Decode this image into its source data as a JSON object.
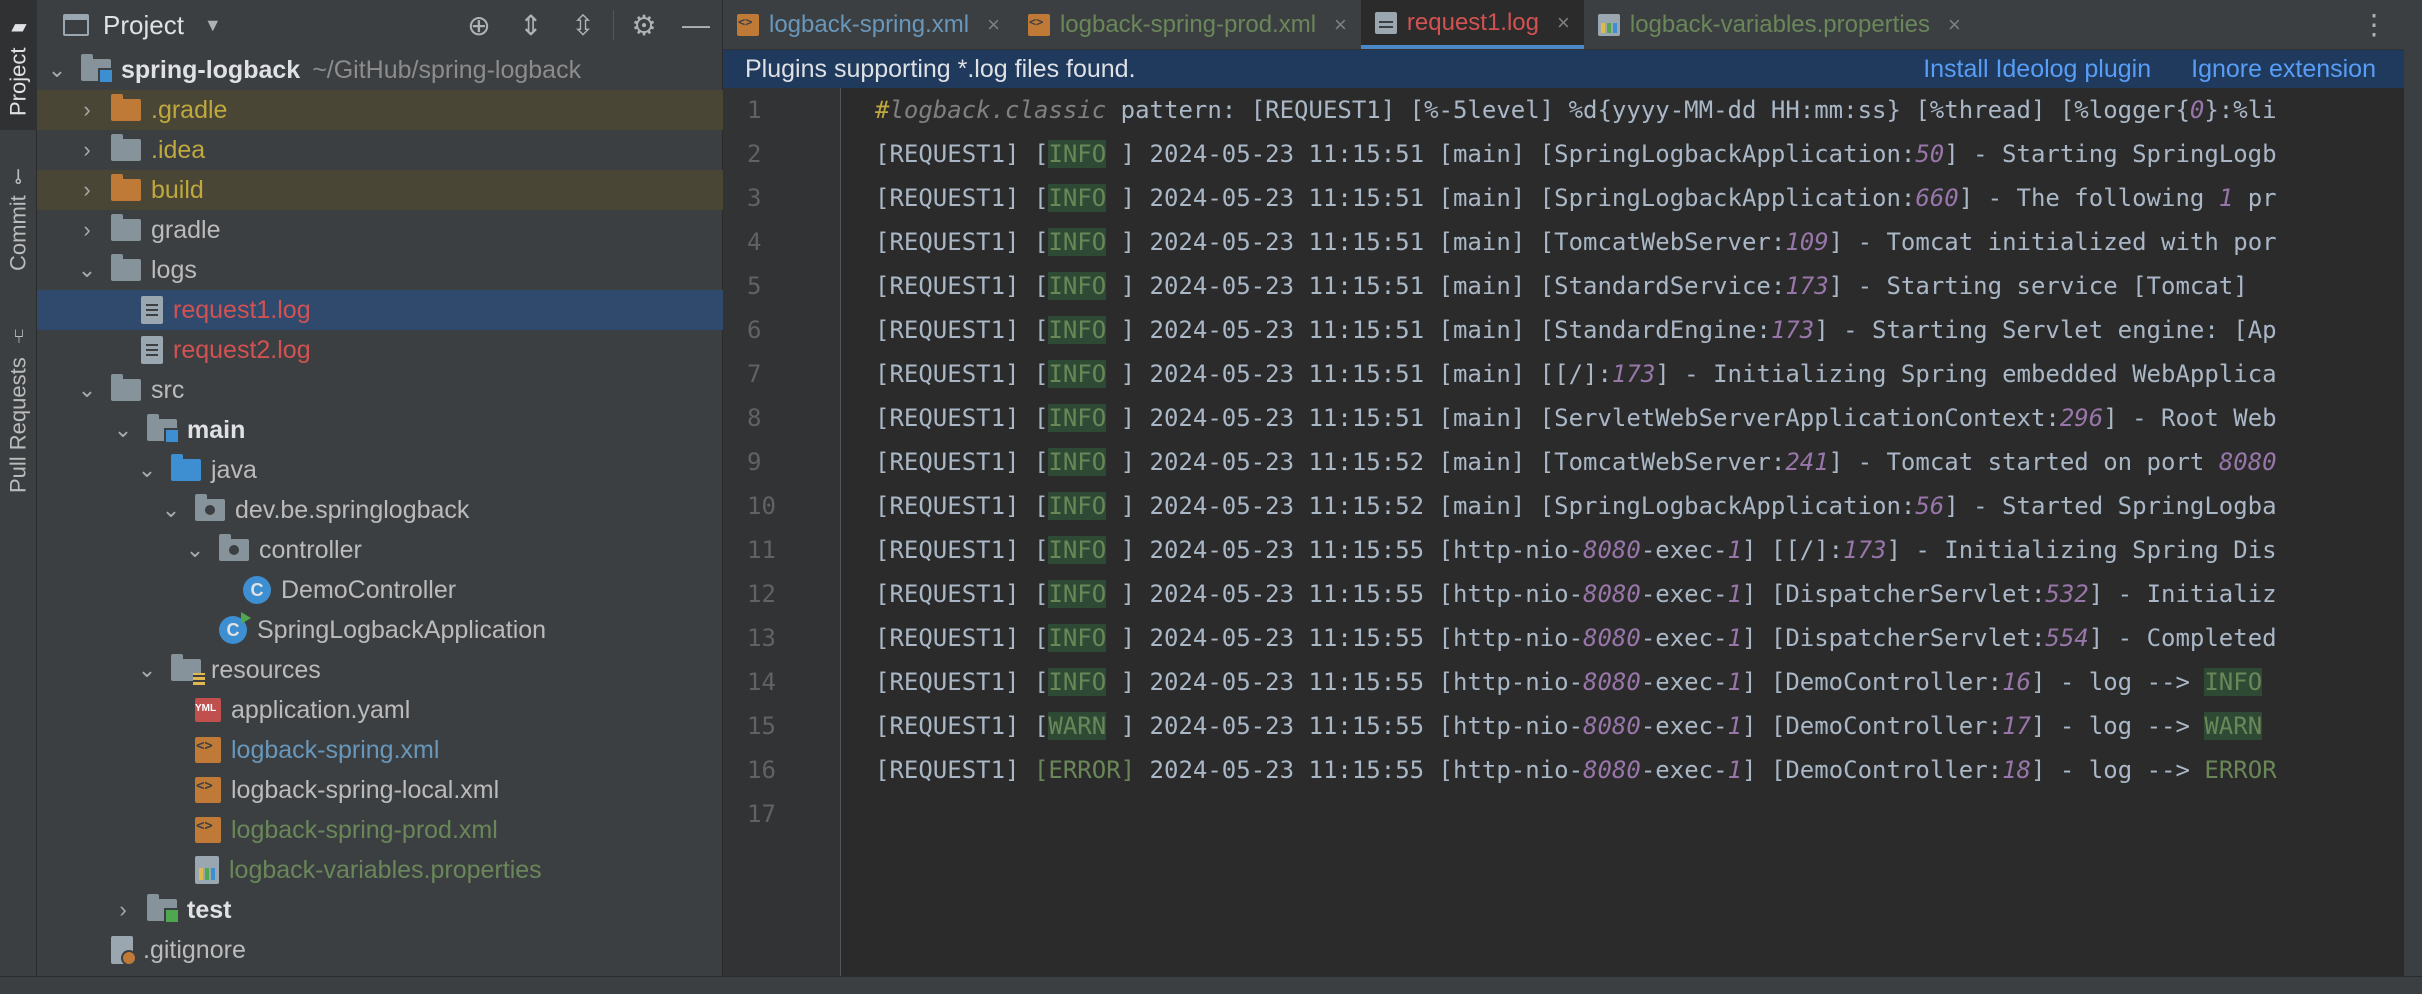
{
  "tool_strip": {
    "project": "Project",
    "commit": "Commit",
    "pull_requests": "Pull Requests"
  },
  "project_panel": {
    "title": "Project",
    "tree": [
      {
        "label": "spring-logback",
        "extra": "~/GitHub/spring-logback"
      },
      {
        "label": ".gradle"
      },
      {
        "label": ".idea"
      },
      {
        "label": "build"
      },
      {
        "label": "gradle"
      },
      {
        "label": "logs"
      },
      {
        "label": "request1.log"
      },
      {
        "label": "request2.log"
      },
      {
        "label": "src"
      },
      {
        "label": "main"
      },
      {
        "label": "java"
      },
      {
        "label": "dev.be.springlogback"
      },
      {
        "label": "controller"
      },
      {
        "label": "DemoController"
      },
      {
        "label": "SpringLogbackApplication"
      },
      {
        "label": "resources"
      },
      {
        "label": "application.yaml"
      },
      {
        "label": "logback-spring.xml"
      },
      {
        "label": "logback-spring-local.xml"
      },
      {
        "label": "logback-spring-prod.xml"
      },
      {
        "label": "logback-variables.properties"
      },
      {
        "label": "test"
      },
      {
        "label": ".gitignore"
      }
    ]
  },
  "editor": {
    "tabs": [
      {
        "label": "logback-spring.xml"
      },
      {
        "label": "logback-spring-prod.xml"
      },
      {
        "label": "request1.log"
      },
      {
        "label": "logback-variables.properties"
      }
    ],
    "banner": {
      "text": "Plugins supporting *.log files found.",
      "install": "Install Ideolog plugin",
      "ignore": "Ignore extension"
    },
    "lines": [
      {
        "n": "1",
        "parts": [
          [
            "cm-hash",
            "#"
          ],
          [
            "cm",
            "logback.classic"
          ],
          [
            "",
            " pattern: [REQUEST1] [%-5level] %d{yyyy-MM-dd HH:mm:ss} [%thread] [%logger{"
          ],
          [
            "num",
            "0"
          ],
          [
            "",
            "}:%li"
          ]
        ]
      },
      {
        "n": "2",
        "parts": [
          [
            "",
            "[REQUEST1] ["
          ],
          [
            "lvl",
            "INFO"
          ],
          [
            "",
            " ] 2024-05-23 11:15:51 [main] [SpringLogbackApplication:"
          ],
          [
            "num",
            "50"
          ],
          [
            "",
            "] - Starting SpringLogb"
          ]
        ]
      },
      {
        "n": "3",
        "parts": [
          [
            "",
            "[REQUEST1] ["
          ],
          [
            "lvl",
            "INFO"
          ],
          [
            "",
            " ] 2024-05-23 11:15:51 [main] [SpringLogbackApplication:"
          ],
          [
            "num",
            "660"
          ],
          [
            "",
            "] - The following "
          ],
          [
            "num",
            "1"
          ],
          [
            "",
            " pr"
          ]
        ]
      },
      {
        "n": "4",
        "parts": [
          [
            "",
            "[REQUEST1] ["
          ],
          [
            "lvl",
            "INFO"
          ],
          [
            "",
            " ] 2024-05-23 11:15:51 [main] [TomcatWebServer:"
          ],
          [
            "num",
            "109"
          ],
          [
            "",
            "] - Tomcat initialized with por"
          ]
        ]
      },
      {
        "n": "5",
        "parts": [
          [
            "",
            "[REQUEST1] ["
          ],
          [
            "lvl",
            "INFO"
          ],
          [
            "",
            " ] 2024-05-23 11:15:51 [main] [StandardService:"
          ],
          [
            "num",
            "173"
          ],
          [
            "",
            "] - Starting service [Tomcat]"
          ]
        ]
      },
      {
        "n": "6",
        "parts": [
          [
            "",
            "[REQUEST1] ["
          ],
          [
            "lvl",
            "INFO"
          ],
          [
            "",
            " ] 2024-05-23 11:15:51 [main] [StandardEngine:"
          ],
          [
            "num",
            "173"
          ],
          [
            "",
            "] - Starting Servlet engine: [Ap"
          ]
        ]
      },
      {
        "n": "7",
        "parts": [
          [
            "",
            "[REQUEST1] ["
          ],
          [
            "lvl",
            "INFO"
          ],
          [
            "",
            " ] 2024-05-23 11:15:51 [main] [[/]:"
          ],
          [
            "num",
            "173"
          ],
          [
            "",
            "] - Initializing Spring embedded WebApplica"
          ]
        ]
      },
      {
        "n": "8",
        "parts": [
          [
            "",
            "[REQUEST1] ["
          ],
          [
            "lvl",
            "INFO"
          ],
          [
            "",
            " ] 2024-05-23 11:15:51 [main] [ServletWebServerApplicationContext:"
          ],
          [
            "num",
            "296"
          ],
          [
            "",
            "] - Root Web"
          ]
        ]
      },
      {
        "n": "9",
        "parts": [
          [
            "",
            "[REQUEST1] ["
          ],
          [
            "lvl",
            "INFO"
          ],
          [
            "",
            " ] 2024-05-23 11:15:52 [main] [TomcatWebServer:"
          ],
          [
            "num",
            "241"
          ],
          [
            "",
            "] - Tomcat started on port "
          ],
          [
            "num",
            "8080"
          ]
        ]
      },
      {
        "n": "10",
        "parts": [
          [
            "",
            "[REQUEST1] ["
          ],
          [
            "lvl",
            "INFO"
          ],
          [
            "",
            " ] 2024-05-23 11:15:52 [main] [SpringLogbackApplication:"
          ],
          [
            "num",
            "56"
          ],
          [
            "",
            "] - Started SpringLogba"
          ]
        ]
      },
      {
        "n": "11",
        "parts": [
          [
            "",
            "[REQUEST1] ["
          ],
          [
            "lvl",
            "INFO"
          ],
          [
            "",
            " ] 2024-05-23 11:15:55 [http-nio-"
          ],
          [
            "num",
            "8080"
          ],
          [
            "",
            "-exec-"
          ],
          [
            "num",
            "1"
          ],
          [
            "",
            "] [[/]:"
          ],
          [
            "num",
            "173"
          ],
          [
            "",
            "] - Initializing Spring Dis"
          ]
        ]
      },
      {
        "n": "12",
        "parts": [
          [
            "",
            "[REQUEST1] ["
          ],
          [
            "lvl",
            "INFO"
          ],
          [
            "",
            " ] 2024-05-23 11:15:55 [http-nio-"
          ],
          [
            "num",
            "8080"
          ],
          [
            "",
            "-exec-"
          ],
          [
            "num",
            "1"
          ],
          [
            "",
            "] [DispatcherServlet:"
          ],
          [
            "num",
            "532"
          ],
          [
            "",
            "] - Initializ"
          ]
        ]
      },
      {
        "n": "13",
        "parts": [
          [
            "",
            "[REQUEST1] ["
          ],
          [
            "lvl",
            "INFO"
          ],
          [
            "",
            " ] 2024-05-23 11:15:55 [http-nio-"
          ],
          [
            "num",
            "8080"
          ],
          [
            "",
            "-exec-"
          ],
          [
            "num",
            "1"
          ],
          [
            "",
            "] [DispatcherServlet:"
          ],
          [
            "num",
            "554"
          ],
          [
            "",
            "] - Completed"
          ]
        ]
      },
      {
        "n": "14",
        "parts": [
          [
            "",
            "[REQUEST1] ["
          ],
          [
            "lvl",
            "INFO"
          ],
          [
            "",
            " ] 2024-05-23 11:15:55 [http-nio-"
          ],
          [
            "num",
            "8080"
          ],
          [
            "",
            "-exec-"
          ],
          [
            "num",
            "1"
          ],
          [
            "",
            "] [DemoController:"
          ],
          [
            "num",
            "16"
          ],
          [
            "",
            "] - log --> "
          ],
          [
            "lvl",
            "INFO"
          ]
        ]
      },
      {
        "n": "15",
        "parts": [
          [
            "",
            "[REQUEST1] ["
          ],
          [
            "lvl",
            "WARN"
          ],
          [
            "",
            " ] 2024-05-23 11:15:55 [http-nio-"
          ],
          [
            "num",
            "8080"
          ],
          [
            "",
            "-exec-"
          ],
          [
            "num",
            "1"
          ],
          [
            "",
            "] [DemoController:"
          ],
          [
            "num",
            "17"
          ],
          [
            "",
            "] - log --> "
          ],
          [
            "lvl",
            "WARN"
          ]
        ]
      },
      {
        "n": "16",
        "parts": [
          [
            "",
            "[REQUEST1] "
          ],
          [
            "err",
            "[ERROR]"
          ],
          [
            "",
            " 2024-05-23 11:15:55 [http-nio-"
          ],
          [
            "num",
            "8080"
          ],
          [
            "",
            "-exec-"
          ],
          [
            "num",
            "1"
          ],
          [
            "",
            "] [DemoController:"
          ],
          [
            "num",
            "18"
          ],
          [
            "",
            "] - log --> "
          ],
          [
            "err",
            "ERROR"
          ]
        ]
      },
      {
        "n": "17",
        "parts": [
          [
            "",
            ""
          ]
        ]
      }
    ]
  },
  "colors": {
    "accent": "#4a88c7",
    "selected_row": "#2f4a6d",
    "ignored_row": "#4a4635",
    "log_level_bg": "#2e4a35"
  }
}
